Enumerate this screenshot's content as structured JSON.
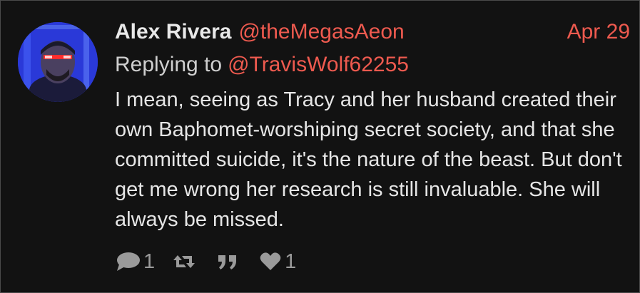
{
  "tweet": {
    "author": {
      "name": "Alex Rivera",
      "handle": "@theMegasAeon",
      "avatar_icon": "user-avatar-icon"
    },
    "timestamp": "Apr 29",
    "reply": {
      "prefix": "Replying to",
      "handle": "@TravisWolf62255"
    },
    "text": "I mean, seeing as Tracy and her husband created their own Baphomet-worshiping secret society, and that she committed suicide, it's the nature of the beast. But don't get me wrong her research is still invaluable. She will always be missed.",
    "actions": {
      "reply": {
        "icon": "comment-icon",
        "count": "1"
      },
      "retweet": {
        "icon": "retweet-icon",
        "count": ""
      },
      "quote": {
        "icon": "quote-icon",
        "count": ""
      },
      "like": {
        "icon": "heart-icon",
        "count": "1"
      }
    },
    "colors": {
      "background": "#121212",
      "accent": "#ee5a4f",
      "text": "#e6e6e6",
      "muted": "#9a9a9a"
    }
  }
}
